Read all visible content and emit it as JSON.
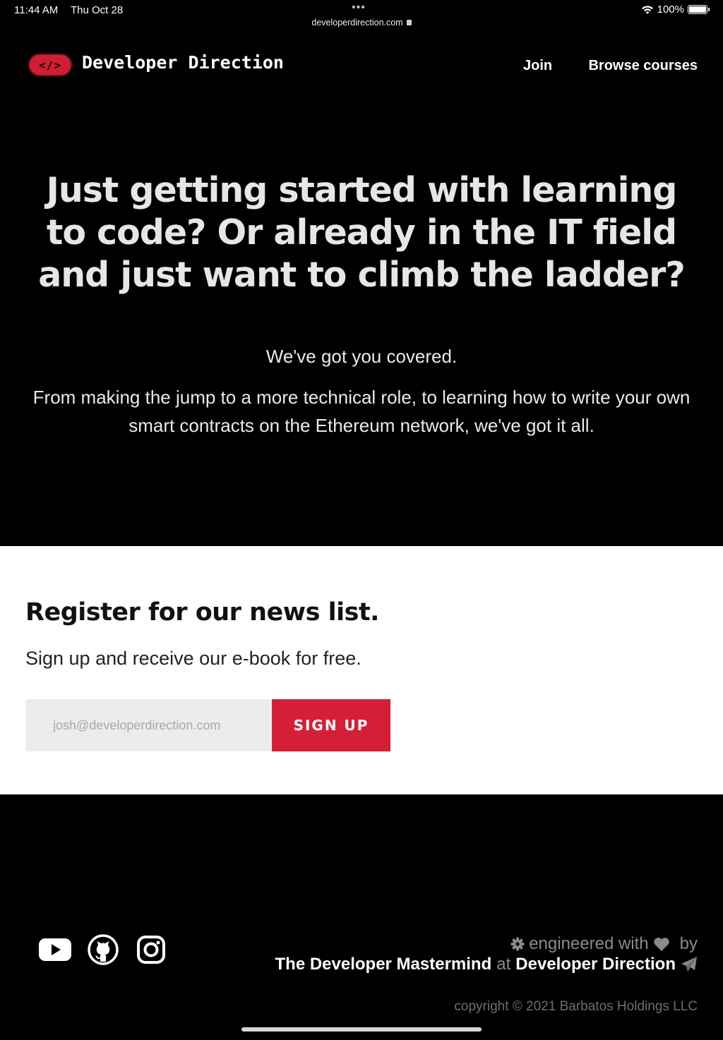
{
  "status_bar": {
    "time": "11:44 AM",
    "date": "Thu Oct 28",
    "url": "developerdirection.com",
    "battery": "100%"
  },
  "header": {
    "logo_badge": "</>",
    "logo_text": "Developer Direction",
    "nav": {
      "join": "Join",
      "browse": "Browse courses"
    }
  },
  "hero": {
    "headline": "Just getting started with learning to code? Or already in the IT field and just want to climb the ladder?",
    "tagline": "We've got you covered.",
    "description": "From making the jump to a more technical role, to learning how to write your own smart contracts on the Ethereum network, we've got it all."
  },
  "newsletter": {
    "title": "Register for our news list.",
    "subtitle": "Sign up and receive our e-book for free.",
    "email_placeholder": "josh@developerdirection.com",
    "button_label": "SIGN UP"
  },
  "footer": {
    "social_icons": [
      "youtube-icon",
      "github-icon",
      "instagram-icon"
    ],
    "engineered_text": "engineered with",
    "by_text": "by",
    "author": "The Developer Mastermind",
    "at_text": "at",
    "company": "Developer Direction",
    "copyright": "copyright © 2021 Barbatos Holdings LLC"
  },
  "colors": {
    "brand_red": "#d41f36",
    "background": "#000000",
    "section_white": "#ffffff"
  }
}
